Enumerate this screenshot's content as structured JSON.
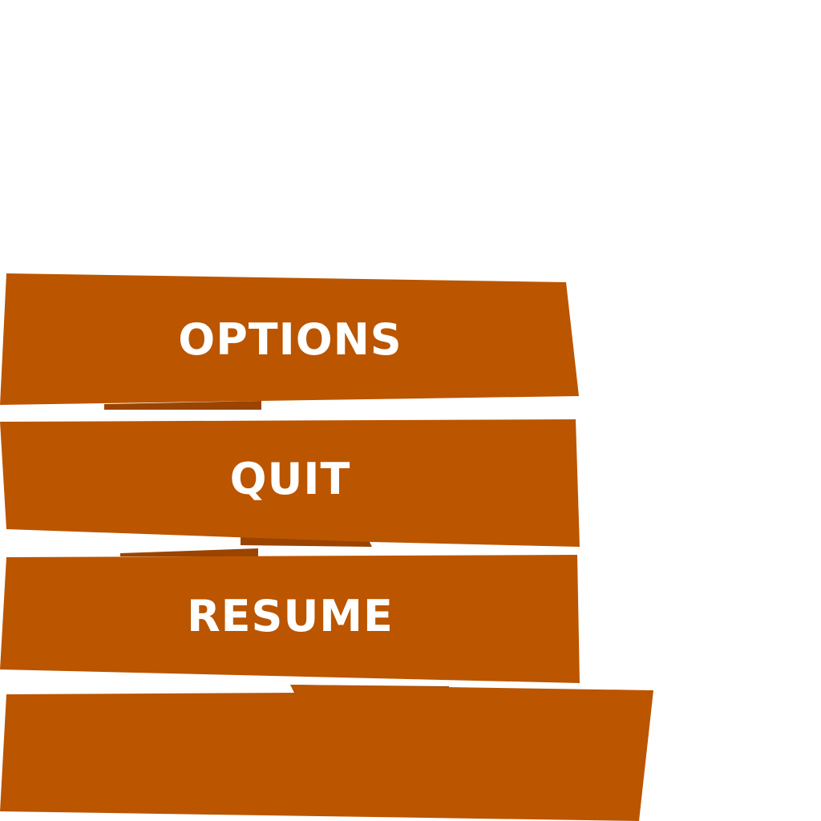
{
  "menu": {
    "buttons": [
      {
        "id": "options",
        "label": "OPTIONS"
      },
      {
        "id": "quit",
        "label": "QUIT"
      },
      {
        "id": "resume",
        "label": "RESUME"
      },
      {
        "id": "blank",
        "label": ""
      }
    ]
  },
  "colors": {
    "background": "#ffffff",
    "plank": "#bb5500",
    "plank_shadow": "#9a4400",
    "label": "#ffffff"
  }
}
